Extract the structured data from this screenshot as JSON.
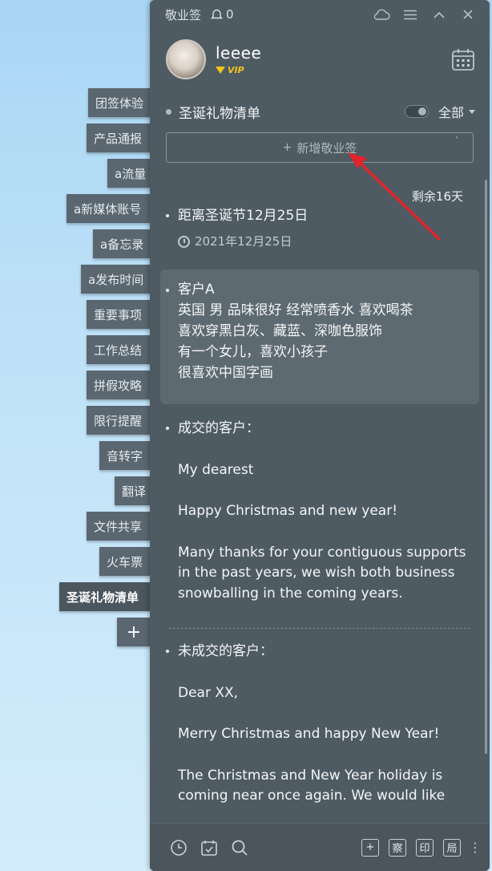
{
  "sidebar": {
    "tabs": [
      {
        "label": "团签体验"
      },
      {
        "label": "产品通报"
      },
      {
        "label": "a流量"
      },
      {
        "label": "a新媒体账号"
      },
      {
        "label": "a备忘录"
      },
      {
        "label": "a发布时间"
      },
      {
        "label": "重要事项"
      },
      {
        "label": "工作总结"
      },
      {
        "label": "拼假攻略"
      },
      {
        "label": "限行提醒"
      },
      {
        "label": "音转字"
      },
      {
        "label": "翻译"
      },
      {
        "label": "文件共享"
      },
      {
        "label": "火车票"
      },
      {
        "label": "圣诞礼物清单"
      }
    ],
    "add_label": "+"
  },
  "titlebar": {
    "app_name": "敬业签",
    "notify_count": "0"
  },
  "user": {
    "name": "leeee",
    "badge": "VIP"
  },
  "list": {
    "name": "圣诞礼物清单",
    "filter": "全部"
  },
  "add_note": {
    "label": "新增敬业签",
    "plus": "+",
    "extra": "`"
  },
  "notes": {
    "remaining": "剩余16天",
    "countdown": {
      "title": "距离圣诞节12月25日",
      "date": "2021年12月25日"
    },
    "customer_a": {
      "title": "客户A",
      "lines": [
        "英国 男 品味很好 经常喷香水 喜欢喝茶",
        "喜欢穿黑白灰、藏蓝、深咖色服饰",
        "有一个女儿，喜欢小孩子",
        "很喜欢中国字画"
      ]
    },
    "closed": {
      "title": "成交的客户：",
      "p1": "My dearest",
      "p2": "Happy Christmas and new year!",
      "p3": "Many thanks for your contiguous supports in the past years, we wish both business snowballing in the coming years."
    },
    "open": {
      "title": "未成交的客户：",
      "p1": "Dear XX,",
      "p2": "Merry Christmas and happy New Year!",
      "p3": "The Christmas and New Year holiday is coming near once again. We would like"
    }
  },
  "bottom": {
    "btn1": "+",
    "btn2": "察",
    "btn3": "印",
    "btn4": "局"
  },
  "colors": {
    "panel": "#4f5b63",
    "tab": "#5a6670",
    "arrow": "#e0242a",
    "vip": "#f3c51a"
  }
}
